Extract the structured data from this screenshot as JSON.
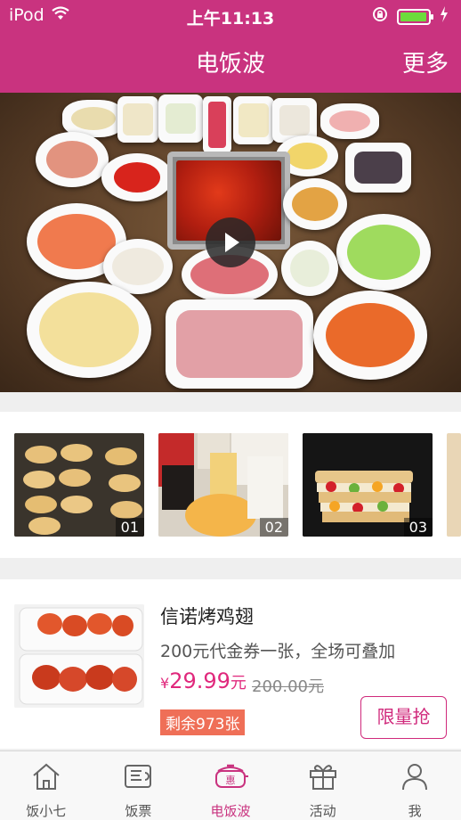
{
  "status_bar": {
    "carrier": "iPod",
    "time": "上午11:13",
    "battery_level": 0.95,
    "battery_color": "#6cdc3c"
  },
  "nav": {
    "title": "电饭波",
    "more": "更多"
  },
  "hero": {
    "icon": "play-icon"
  },
  "thumbnails": [
    {
      "label": "01"
    },
    {
      "label": "02"
    },
    {
      "label": "03"
    }
  ],
  "deal": {
    "title": "信诺烤鸡翅",
    "description": "200元代金券一张，全场可叠加",
    "price_symbol": "¥",
    "price": "29.99",
    "price_unit": "元",
    "original_price": "200.00元",
    "stock": "剩余973张",
    "button": "限量抢"
  },
  "tabs": [
    {
      "label": "饭小七",
      "icon": "home-icon",
      "active": false
    },
    {
      "label": "饭票",
      "icon": "ticket-icon",
      "active": false
    },
    {
      "label": "电饭波",
      "icon": "rice-cooker-icon",
      "active": true
    },
    {
      "label": "活动",
      "icon": "gift-icon",
      "active": false
    },
    {
      "label": "我",
      "icon": "user-icon",
      "active": false
    }
  ],
  "colors": {
    "brand": "#c9337f",
    "price": "#e0287c",
    "stock_badge": "#ef6f57"
  }
}
